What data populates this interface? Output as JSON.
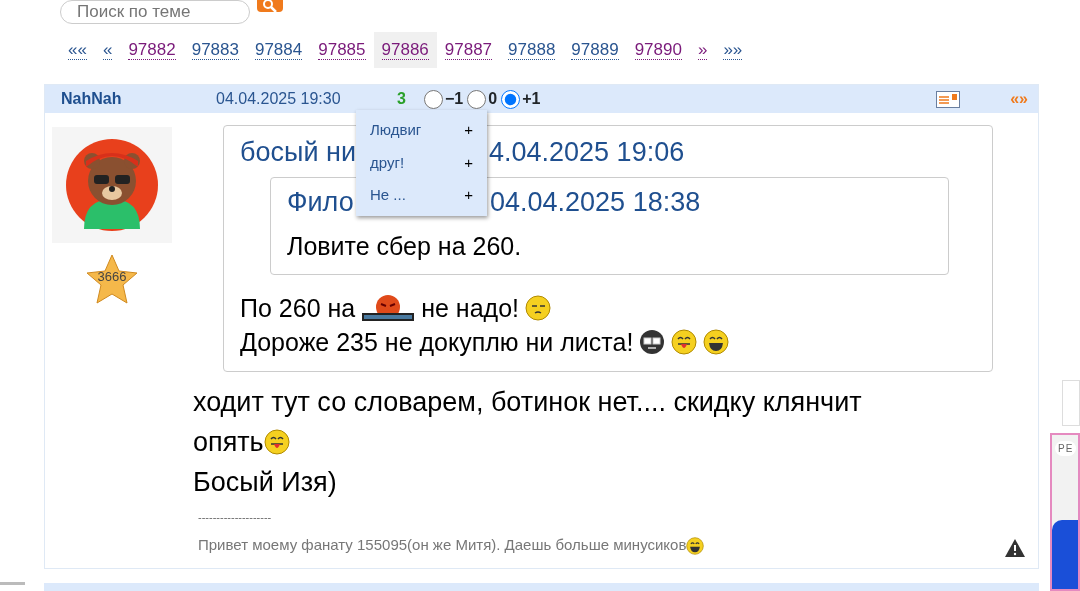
{
  "search": {
    "placeholder": "Поиск по теме"
  },
  "pagination": [
    {
      "label": "««",
      "selected": false,
      "visited": false
    },
    {
      "label": "«",
      "selected": false,
      "visited": false
    },
    {
      "label": "97882",
      "selected": false,
      "visited": true
    },
    {
      "label": "97883",
      "selected": false,
      "visited": false
    },
    {
      "label": "97884",
      "selected": false,
      "visited": false
    },
    {
      "label": "97885",
      "selected": false,
      "visited": true
    },
    {
      "label": "97886",
      "selected": true,
      "visited": true
    },
    {
      "label": "97887",
      "selected": false,
      "visited": true
    },
    {
      "label": "97888",
      "selected": false,
      "visited": false
    },
    {
      "label": "97889",
      "selected": false,
      "visited": false
    },
    {
      "label": "97890",
      "selected": false,
      "visited": true
    },
    {
      "label": "»",
      "selected": false,
      "visited": true
    },
    {
      "label": "»»",
      "selected": false,
      "visited": false
    }
  ],
  "post": {
    "author": "NahNah",
    "date": "04.04.2025 19:30",
    "rating": "3",
    "votes": [
      {
        "label": "−1",
        "selected": false
      },
      {
        "label": "0",
        "selected": false
      },
      {
        "label": "+1",
        "selected": true
      }
    ],
    "quote_link": "«»",
    "vote_menu": [
      {
        "label": "Людвиг",
        "action": "+"
      },
      {
        "label": "друг!",
        "action": "+"
      },
      {
        "label": "Не ...",
        "action": "+"
      }
    ],
    "rank": "3666",
    "quote": {
      "author": "босый ни",
      "date": "4.04.2025 19:06",
      "inner_quote": {
        "author": "Фило",
        "date": "04.04.2025 18:38",
        "text": "Ловите сбер на 260."
      },
      "lines": [
        [
          {
            "kind": "text",
            "text": "По 260 на"
          },
          {
            "kind": "censored"
          },
          {
            "kind": "text",
            "text": "не надо!"
          },
          {
            "kind": "sleepy"
          }
        ],
        [
          {
            "kind": "text",
            "text": "Дороже 235 не докуплю ни листа!"
          },
          {
            "kind": "nerd"
          },
          {
            "kind": "tongue"
          },
          {
            "kind": "grin"
          }
        ]
      ]
    },
    "body": [
      [
        {
          "kind": "text",
          "text": "ходит тут со словарем, ботинок нет.... скидку клянчит"
        }
      ],
      [
        {
          "kind": "text",
          "text": "опять"
        },
        {
          "kind": "tongue"
        }
      ],
      [
        {
          "kind": "text",
          "text": "Босый Изя)"
        }
      ]
    ],
    "signature_rule": "--------------------",
    "signature": [
      {
        "kind": "text",
        "text": "Привет моему фанату 155095(он же Митя). Даешь больше минусиков"
      },
      {
        "kind": "grin"
      }
    ]
  },
  "ad": {
    "label": "РЕ"
  }
}
